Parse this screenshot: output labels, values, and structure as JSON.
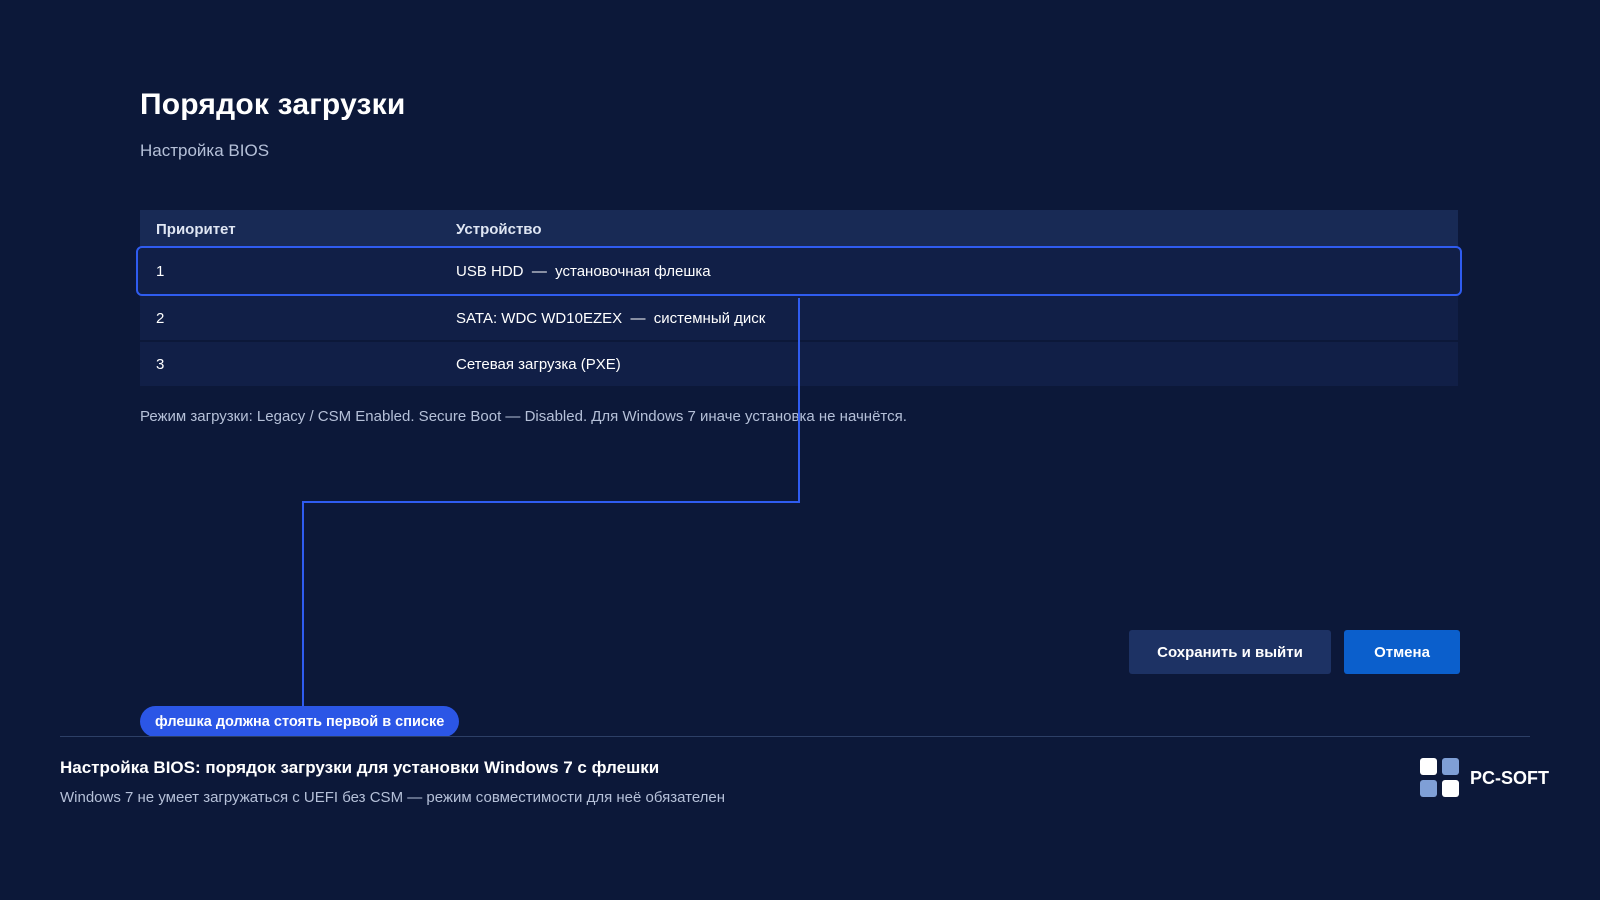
{
  "page": {
    "title": "Порядок загрузки",
    "subtitle": "Настройка BIOS"
  },
  "table": {
    "columns": [
      "Приоритет",
      "Устройство"
    ],
    "rows": [
      {
        "priority": "1",
        "device": "USB HDD  —  установочная флешка",
        "selected": true
      },
      {
        "priority": "2",
        "device": "SATA: WDC WD10EZEX  —  системный диск",
        "selected": false
      },
      {
        "priority": "3",
        "device": "Сетевая загрузка (PXE)",
        "selected": false
      }
    ]
  },
  "note": "Режим загрузки: Legacy / CSM Enabled. Secure Boot — Disabled. Для Windows 7 иначе установка не начнётся.",
  "buttons": {
    "save_label": "Сохранить и выйти",
    "cancel_label": "Отмена"
  },
  "callout": "флешка должна стоять первой в списке",
  "footer": {
    "title": "Настройка BIOS: порядок загрузки для установки Windows 7 с флешки",
    "subtitle": "Windows 7 не умеет загружаться с UEFI без CSM — режим совместимости для неё обязателен",
    "brand": "PC-SOFT"
  },
  "colors": {
    "background": "#0c1839",
    "accent": "#2f5cf0",
    "cancel_button": "#0b5fcc",
    "save_button": "#1d3264"
  }
}
